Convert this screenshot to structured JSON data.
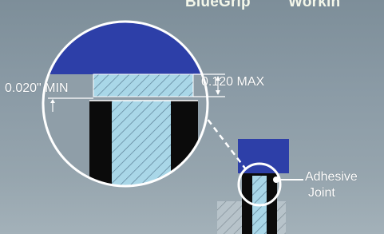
{
  "title": {
    "brand": "BlueGrip",
    "separator": "—",
    "suffix": "Workin"
  },
  "labels": {
    "min_gap": "0.020\" MIN",
    "max_gap": "0.120 MAX",
    "adhesive": "Adhesive",
    "joint": "Joint"
  },
  "colors": {
    "cap_blue": "#2d3fa8",
    "insert_light_blue": "#a9d7e8",
    "post_black": "#0b0b0b",
    "outline_white": "#ffffff",
    "background": "#8b9ba6"
  }
}
